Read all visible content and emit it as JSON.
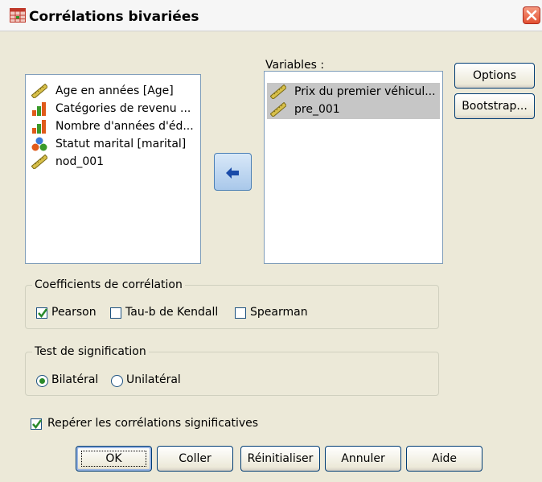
{
  "window": {
    "title": "Corrélations bivariées"
  },
  "source_list": {
    "items": [
      {
        "label": "Age en années [Age]",
        "icon": "scale-ruler-icon"
      },
      {
        "label": "Catégories de revenu ...",
        "icon": "ordinal-bars-icon"
      },
      {
        "label": "Nombre d'années d'éd...",
        "icon": "ordinal-bars-icon"
      },
      {
        "label": "Statut marital [marital]",
        "icon": "nominal-circles-icon"
      },
      {
        "label": "nod_001",
        "icon": "scale-ruler-icon"
      }
    ]
  },
  "variables": {
    "label": "Variables :",
    "items": [
      {
        "label": "Prix du premier véhicul...",
        "icon": "scale-ruler-icon",
        "selected": true
      },
      {
        "label": "pre_001",
        "icon": "scale-ruler-icon",
        "selected": true
      }
    ]
  },
  "side_buttons": {
    "options": "Options",
    "bootstrap": "Bootstrap..."
  },
  "coefficients": {
    "title": "Coefficients de corrélation",
    "pearson": {
      "label": "Pearson",
      "checked": true
    },
    "kendall": {
      "label": "Tau-b de Kendall",
      "checked": false
    },
    "spearman": {
      "label": "Spearman",
      "checked": false
    }
  },
  "significance": {
    "title": "Test de signification",
    "bilateral": {
      "label": "Bilatéral",
      "selected": true
    },
    "unilateral": {
      "label": "Unilatéral",
      "selected": false
    }
  },
  "flag": {
    "label": "Repérer les corrélations significatives",
    "checked": true
  },
  "buttons": {
    "ok": "OK",
    "paste": "Coller",
    "reset": "Réinitialiser",
    "cancel": "Annuler",
    "help": "Aide"
  },
  "colors": {
    "accent": "#0a246a",
    "selection": "#c6c6c6",
    "dialog_bg": "#ece9d8"
  }
}
